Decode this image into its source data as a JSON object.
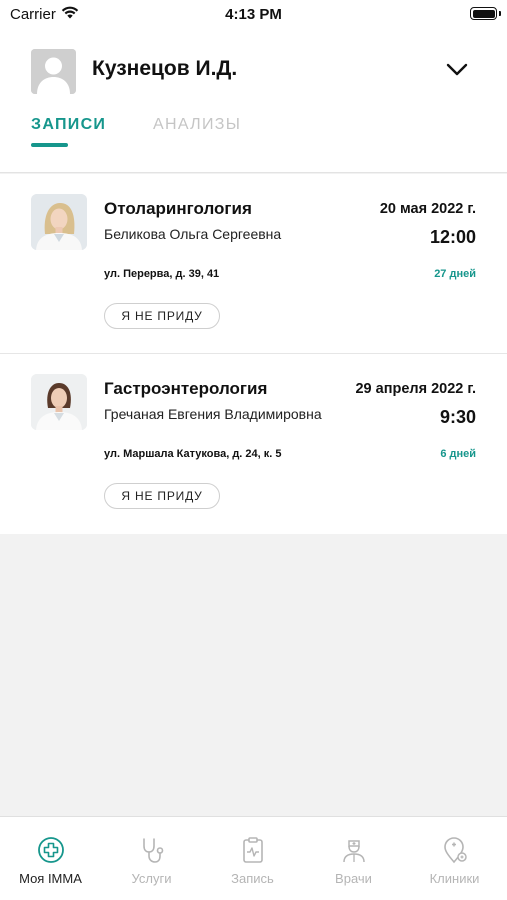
{
  "status_bar": {
    "carrier": "Carrier",
    "time": "4:13 PM"
  },
  "profile": {
    "name": "Кузнецов И.Д."
  },
  "tabs": [
    {
      "label": "ЗАПИСИ",
      "active": true
    },
    {
      "label": "АНАЛИЗЫ",
      "active": false
    }
  ],
  "appointments": [
    {
      "specialty": "Отоларингология",
      "doctor": "Беликова Ольга Сергеевна",
      "date": "20 мая 2022 г.",
      "time": "12:00",
      "address": "ул. Перерва, д. 39, 41",
      "days_left": "27 дней",
      "cancel_label": "Я НЕ ПРИДУ"
    },
    {
      "specialty": "Гастроэнтерология",
      "doctor": "Гречаная Евгения Владимировна",
      "date": "29 апреля 2022 г.",
      "time": "9:30",
      "address": "ул. Маршала Катукова, д. 24, к. 5",
      "days_left": "6 дней",
      "cancel_label": "Я НЕ ПРИДУ"
    }
  ],
  "bottom_nav": [
    {
      "label": "Моя IMMA",
      "icon": "medical-cross-icon",
      "active": true
    },
    {
      "label": "Услуги",
      "icon": "stethoscope-icon",
      "active": false
    },
    {
      "label": "Запись",
      "icon": "clipboard-icon",
      "active": false
    },
    {
      "label": "Врачи",
      "icon": "doctor-icon",
      "active": false
    },
    {
      "label": "Клиники",
      "icon": "map-pin-icon",
      "active": false
    }
  ],
  "colors": {
    "accent": "#16968c",
    "inactive": "#b5b5b5",
    "background": "#f2f2f2"
  }
}
